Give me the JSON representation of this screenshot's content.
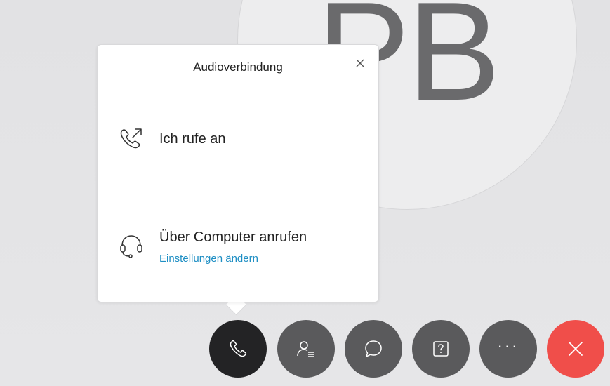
{
  "avatar": {
    "initials": "PB"
  },
  "popover": {
    "title": "Audioverbindung",
    "close_icon": "close-icon",
    "options": [
      {
        "icon": "phone-outgoing-icon",
        "label": "Ich rufe an"
      },
      {
        "icon": "headset-icon",
        "label": "Über Computer anrufen",
        "link": "Einstellungen ändern"
      }
    ]
  },
  "toolbar": {
    "buttons": [
      {
        "icon": "phone-icon",
        "state": "active"
      },
      {
        "icon": "participants-icon"
      },
      {
        "icon": "chat-icon"
      },
      {
        "icon": "question-icon"
      },
      {
        "icon": "more-icon",
        "text": "···"
      },
      {
        "icon": "end-call-icon"
      }
    ]
  },
  "colors": {
    "link": "#1f8fc4",
    "end_call": "#f04e4a",
    "toolbar_button": "#5a5a5c",
    "toolbar_active": "#232325"
  }
}
